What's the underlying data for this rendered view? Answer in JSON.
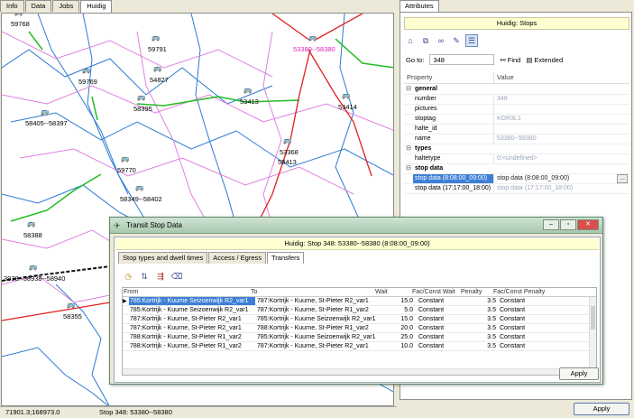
{
  "left_tabs": [
    "Info",
    "Data",
    "Jobs",
    "Huidig"
  ],
  "map": {
    "stops": [
      {
        "label": "59768",
        "color": "normal"
      },
      {
        "label": "59791",
        "color": "normal"
      },
      {
        "label": "53380--58380",
        "color": "pink"
      },
      {
        "label": "59769",
        "color": "normal"
      },
      {
        "label": "54827",
        "color": "normal"
      },
      {
        "label": "58395",
        "color": "normal"
      },
      {
        "label": "53413",
        "color": "normal"
      },
      {
        "label": "53414",
        "color": "normal"
      },
      {
        "label": "58405--58397",
        "color": "normal"
      },
      {
        "label": "53368",
        "color": "normal"
      },
      {
        "label": "58413",
        "color": "normal"
      },
      {
        "label": "59770",
        "color": "normal"
      },
      {
        "label": "58349--58402",
        "color": "normal"
      },
      {
        "label": "58388",
        "color": "normal"
      },
      {
        "label": "3938--58938--58940",
        "color": "normal"
      },
      {
        "label": "58355",
        "color": "normal"
      }
    ]
  },
  "status": {
    "coords": "71901.3;168973.0",
    "stop": "Stop 348: 53380--58380"
  },
  "attributes": {
    "tab": "Attributes",
    "title": "Huidig: Stops",
    "goto_label": "Go to:",
    "goto_value": "348",
    "find_label": "Find",
    "extended_label": "Extended",
    "col_property": "Property",
    "col_value": "Value",
    "rows": [
      {
        "type": "cat",
        "exp": "⊟",
        "k": "general"
      },
      {
        "type": "row",
        "k": "number",
        "v": "348"
      },
      {
        "type": "row",
        "k": "pictures",
        "v": ""
      },
      {
        "type": "row",
        "k": "stoptag",
        "v": "KOR3L1"
      },
      {
        "type": "row",
        "k": "halte_id",
        "v": ""
      },
      {
        "type": "row",
        "k": "name",
        "v": "53380--58380"
      },
      {
        "type": "cat",
        "exp": "⊟",
        "k": "types"
      },
      {
        "type": "row",
        "k": "haltetype",
        "v": "0:<undefined>"
      },
      {
        "type": "cat",
        "exp": "⊟",
        "k": "stop data"
      },
      {
        "type": "row",
        "k": "stop data (8:08:00_09:00)",
        "v": "stop data (8:08:00_09:00)",
        "sel": true
      },
      {
        "type": "row",
        "k": "stop data (17:17:00_18:00)",
        "v": "stop data (17:17:00_18:00)"
      }
    ],
    "apply": "Apply"
  },
  "dialog": {
    "title": "Transit Stop Data",
    "banner": "Huidig: Stop 348: 53380--58380 (8:08:00_09:00)",
    "tabs": [
      "Stop types and dwell times",
      "Access / Egress",
      "Transfers"
    ],
    "columns": [
      "From",
      "To",
      "Wait",
      "Fac/Const Wait",
      "Penalty",
      "Fac/Const Penalty"
    ],
    "rows": [
      [
        "785:Kortrijk - Kuurne Seizoenwijk R2_var1",
        "787:Kortrijk - Kuurne, St-Pieter R2_var1",
        "15.0",
        "Constant",
        "3.5",
        "Constant"
      ],
      [
        "785:Kortrijk - Kuurne Seizoenwijk R2_var1",
        "787:Kortrijk - Kuurne, St-Pieter R1_var2",
        "5.0",
        "Constant",
        "3.5",
        "Constant"
      ],
      [
        "787:Kortrijk - Kuurne, St-Pieter R2_var1",
        "785:Kortrijk - Kuurne Seizoenwijk R2_var1",
        "15.0",
        "Constant",
        "3.5",
        "Constant"
      ],
      [
        "787:Kortrijk - Kuurne, St-Pieter R2_var1",
        "788:Kortrijk - Kuurne, St-Pieter R1_var2",
        "20.0",
        "Constant",
        "3.5",
        "Constant"
      ],
      [
        "788:Kortrijk - Kuurne, St-Pieter R1_var2",
        "785:Kortrijk - Kuurne Seizoenwijk R2_var1",
        "25.0",
        "Constant",
        "3.5",
        "Constant"
      ],
      [
        "788:Kortrijk - Kuurne, St-Pieter R1_var2",
        "787:Kortrijk - Kuurne, St-Pieter R2_var1",
        "10.0",
        "Constant",
        "3.5",
        "Constant"
      ]
    ],
    "apply": "Apply"
  }
}
